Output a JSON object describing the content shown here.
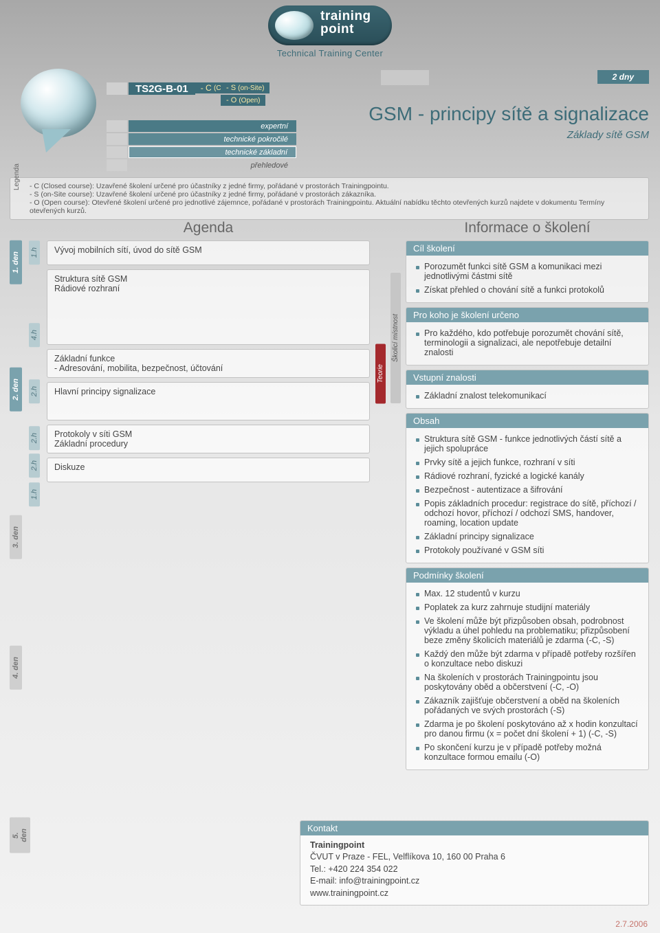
{
  "logo": {
    "line1": "training",
    "line2": "point",
    "subtitle": "Technical Training Center"
  },
  "code": {
    "id": "TS2G-B-01",
    "variants": [
      {
        "k": "- C",
        "v": "(Closed)"
      },
      {
        "k": "- S",
        "v": "(on-Site)"
      },
      {
        "k": "- O",
        "v": "(Open)"
      }
    ]
  },
  "levels": {
    "expertni": "expertní",
    "pokrocile": "technické pokročilé",
    "zakladni": "technické základní",
    "prehledove": "přehledové"
  },
  "header": {
    "duration": "2 dny",
    "title": "GSM - principy sítě a signalizace",
    "subtitle": "Základy sítě GSM"
  },
  "legenda": {
    "label": "Legenda",
    "l1": "- C (Closed course): Uzavřené školení určené pro účastníky z jedné firmy, pořádané v prostorách Trainingpointu.",
    "l2": "- S (on-Site course): Uzavřené školení určené pro účastníky z jedné firmy, pořádané v prostorách zákazníka.",
    "l3": "- O (Open course):  Otevřené školení určené pro jednotlivé zájemnce, pořádané v prostorách Trainingpointu. Aktuální nabídku těchto otevřených kurzů najdete v dokumentu Termíny otevřených kurzů."
  },
  "day_labels": [
    "1. den",
    "2. den",
    "3. den",
    "4. den",
    "5. den"
  ],
  "hours": [
    "1.h",
    "4.h",
    "2.h",
    "2.h",
    "2.h",
    "1.h"
  ],
  "agenda": {
    "title": "Agenda",
    "blocks": [
      "Vývoj mobilních sítí, úvod do sítě GSM",
      "Struktura sítě GSM\nRádiové rozhraní",
      "Základní funkce\n- Adresování, mobilita, bezpečnost, účtování",
      "Hlavní principy signalizace",
      "Protokoly v síti GSM\nZákladní procedury",
      "Diskuze"
    ],
    "side_labels": {
      "teorie": "Teorie",
      "mistnost": "Školicí místnost"
    }
  },
  "info": {
    "title": "Informace o školení",
    "cil": {
      "h": "Cíl školení",
      "items": [
        "Porozumět funkci sítě GSM a komunikaci mezi jednotlivými částmi sítě",
        "Získat přehled o chování sítě a funkci protokolů"
      ]
    },
    "komu": {
      "h": "Pro koho je školení určeno",
      "items": [
        "Pro každého, kdo potřebuje porozumět chování sítě, terminologii a signalizaci, ale nepotřebuje detailní znalosti"
      ]
    },
    "vstup": {
      "h": "Vstupní znalosti",
      "items": [
        "Základní znalost telekomunikací"
      ]
    },
    "obsah": {
      "h": "Obsah",
      "items": [
        "Struktura sítě GSM - funkce jednotlivých částí sítě a jejich spolupráce",
        "Prvky sítě a jejich funkce, rozhraní v síti",
        "Rádiové rozhraní, fyzické a logické kanály",
        "Bezpečnost - autentizace a šifrování",
        "Popis základních procedur: registrace do sítě, příchozí / odchozí hovor, příchozí / odchozí SMS, handover, roaming, location update",
        "Základní principy signalizace",
        "Protokoly používané v GSM síti"
      ]
    },
    "podm": {
      "h": "Podmínky školení",
      "items": [
        "Max.  12 studentů v kurzu",
        "Poplatek za kurz zahrnuje studijní materiály",
        "Ve školení může být přizpůsoben obsah, podrobnost výkladu a úhel pohledu na problematiku; přizpůsobení beze změny školicích materiálů je zdarma (-C, -S)",
        "Každý den může být zdarma v případě potřeby rozšířen o konzultace nebo diskuzi",
        "Na školeních v prostorách Trainingpointu jsou poskytovány oběd a občerstvení (-C, -O)",
        "Zákazník zajišťuje občerstvení a oběd na školeních pořádaných ve svých prostorách (-S)",
        "Zdarma je po školení poskytováno až x hodin konzultací pro danou firmu (x = počet dní školení + 1) (-C, -S)",
        "Po skončení kurzu je v případě potřeby možná konzultace formou emailu (-O)"
      ]
    }
  },
  "kontakt": {
    "h": "Kontakt",
    "name": "Trainingpoint",
    "addr": "ČVUT v Praze - FEL, Velflíkova 10, 160 00  Praha 6",
    "tel": "Tel.: +420 224 354 022",
    "email": "E-mail: info@trainingpoint.cz",
    "web": "www.trainingpoint.cz"
  },
  "footer_date": "2.7.2006"
}
